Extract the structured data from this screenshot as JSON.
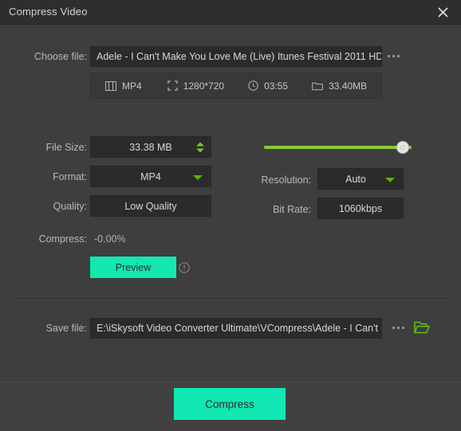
{
  "window": {
    "title": "Compress Video",
    "close_icon": "close-icon"
  },
  "choose_file": {
    "label": "Choose file:",
    "value": "Adele - I Can't Make You Love Me (Live) Itunes Festival 2011 HD",
    "placeholder": "Choose file",
    "browse_label": "..."
  },
  "media_info": [
    {
      "icon": "film-icon",
      "text": "MP4"
    },
    {
      "icon": "resize-icon",
      "text": "1280*720"
    },
    {
      "icon": "clock-icon",
      "text": "03:55"
    },
    {
      "icon": "folder-icon",
      "text": "33.40MB"
    }
  ],
  "settings": {
    "file_size": {
      "label": "File Size:",
      "value": "33.38  MB",
      "spinner_icon": "spinner-up-down-icon"
    },
    "format": {
      "label": "Format:",
      "value": "MP4",
      "caret_icon": "chevron-down-icon"
    },
    "quality": {
      "label": "Quality:",
      "value": "Low Quality"
    },
    "resolution": {
      "label": "Resolution:",
      "value": "Auto",
      "caret_icon": "chevron-down-icon"
    },
    "bit_rate": {
      "label": "Bit Rate:",
      "value": "1060kbps"
    },
    "slider": {
      "value": 100,
      "min": 0,
      "max": 100
    }
  },
  "compress_ratio": {
    "label": "Compress:",
    "value": "-0.00%"
  },
  "preview": {
    "label": "Preview",
    "info_icon": "info-circle-icon"
  },
  "save_file": {
    "label": "Save file:",
    "value": "E:\\iSkysoft Video Converter Ultimate\\VCompress\\Adele - I Can't M",
    "placeholder": "Save file path",
    "browse_label": "...",
    "folder_icon": "folder-open-icon"
  },
  "footer": {
    "compress_label": "Compress"
  },
  "colors": {
    "accent_teal": "#11e8b3",
    "accent_green": "#8ac93a",
    "caret_green": "#57b50d",
    "window_bg": "#3e3e3e",
    "titlebar_bg": "#2e2e2e",
    "field_bg": "#2b2b2b",
    "footer_bg": "#414141"
  }
}
